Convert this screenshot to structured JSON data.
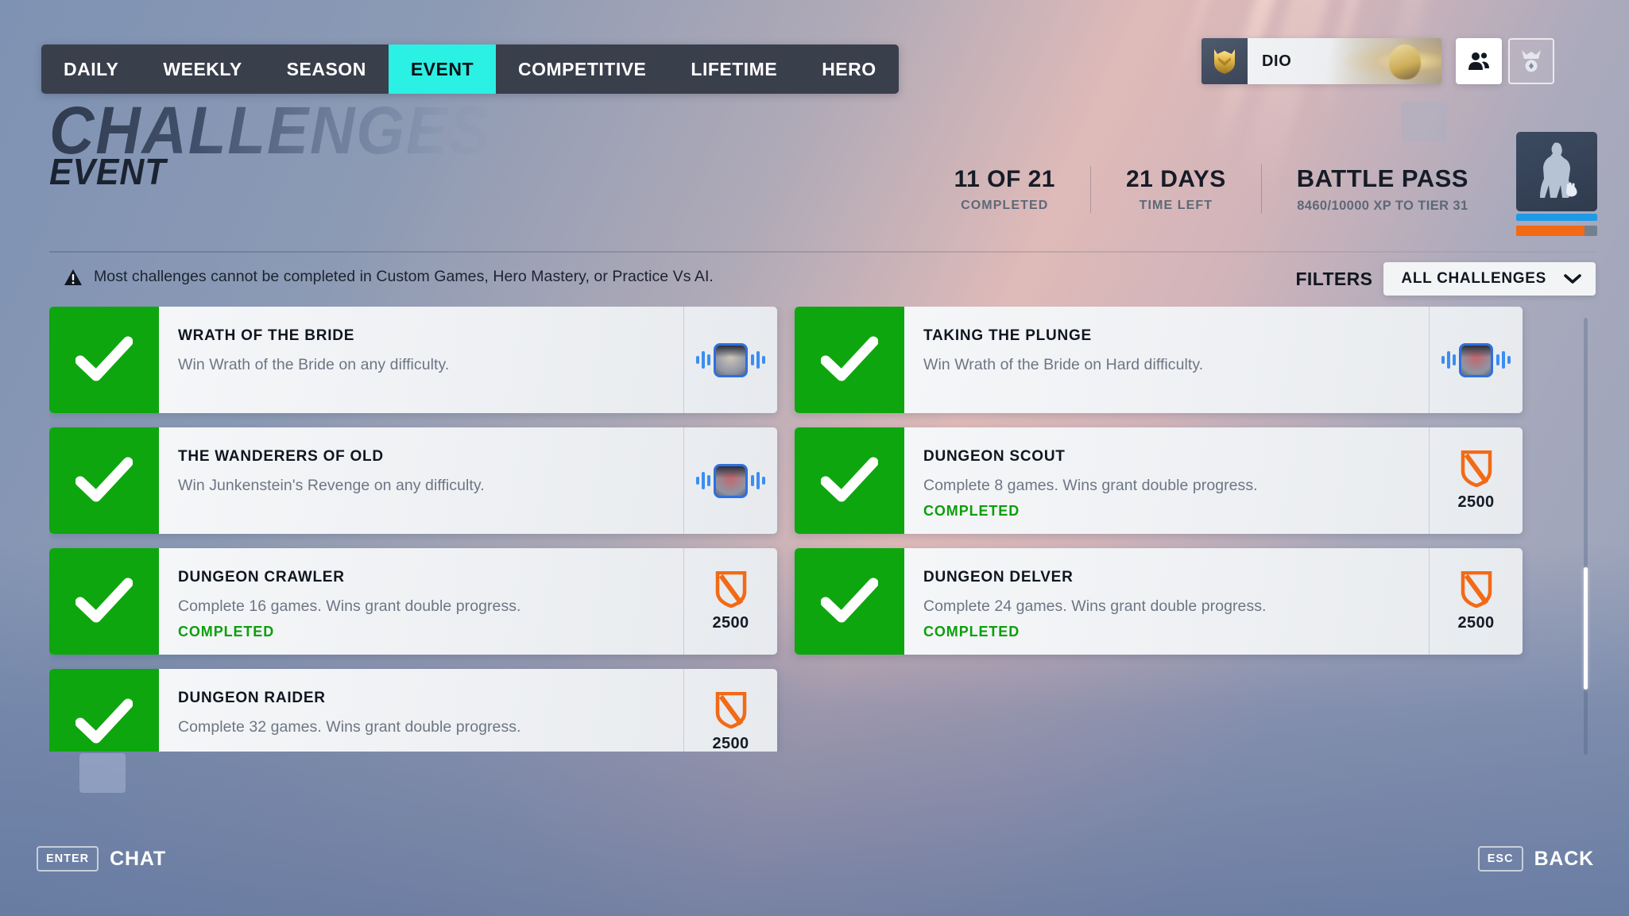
{
  "nav": {
    "tabs": [
      {
        "label": "DAILY",
        "active": false
      },
      {
        "label": "WEEKLY",
        "active": false
      },
      {
        "label": "SEASON",
        "active": false
      },
      {
        "label": "EVENT",
        "active": true
      },
      {
        "label": "COMPETITIVE",
        "active": false
      },
      {
        "label": "LIFETIME",
        "active": false
      },
      {
        "label": "HERO",
        "active": false
      }
    ],
    "active_tab": "EVENT",
    "active_color": "#2bf0e4"
  },
  "header": {
    "title": "CHALLENGES",
    "subtitle": "EVENT",
    "stats": [
      {
        "value": "11 OF 21",
        "label": "COMPLETED"
      },
      {
        "value": "21 DAYS",
        "label": "TIME LEFT"
      },
      {
        "value": "BATTLE PASS",
        "label": "8460/10000 XP TO TIER 31"
      }
    ]
  },
  "profile": {
    "name": "DIO",
    "badge_icon": "gold-shield-icon",
    "social_icon": "social-people-icon",
    "career_icon": "career-medal-icon"
  },
  "battle_pass": {
    "tier_progress_percent": 84,
    "accent_color": "#f26a16",
    "bar_color": "#1e9ae6",
    "thumb_icon": "hero-silhouette-icon"
  },
  "notice": {
    "icon": "warning-triangle-icon",
    "text": "Most challenges cannot be completed in Custom Games, Hero Mastery, or Practice Vs AI."
  },
  "filters": {
    "label": "FILTERS",
    "selected": "ALL CHALLENGES",
    "chevron_icon": "chevron-down-icon"
  },
  "challenges": {
    "left_column": [
      {
        "title": "WRATH OF THE BRIDE",
        "description": "Win Wrath of the Bride on any difficulty.",
        "status": "",
        "completed": true,
        "reward_type": "voice-line",
        "reward_amount": "",
        "portrait_tone": "#cfc6b8"
      },
      {
        "title": "THE WANDERERS OF OLD",
        "description": "Win Junkenstein's Revenge on any difficulty.",
        "status": "",
        "completed": true,
        "reward_type": "voice-line",
        "reward_amount": "",
        "portrait_tone": "#c4666a"
      },
      {
        "title": "DUNGEON CRAWLER",
        "description": "Complete 16 games. Wins grant double progress.",
        "status": "COMPLETED",
        "completed": true,
        "reward_type": "battle-pass-xp",
        "reward_amount": "2500",
        "portrait_tone": ""
      },
      {
        "title": "DUNGEON RAIDER",
        "description": "Complete 32 games. Wins grant double progress.",
        "status": "",
        "completed": true,
        "reward_type": "battle-pass-xp",
        "reward_amount": "2500",
        "portrait_tone": ""
      }
    ],
    "right_column": [
      {
        "title": "TAKING THE PLUNGE",
        "description": "Win Wrath of the Bride on Hard difficulty.",
        "status": "",
        "completed": true,
        "reward_type": "voice-line",
        "reward_amount": "",
        "portrait_tone": "#c4666a"
      },
      {
        "title": "DUNGEON SCOUT",
        "description": "Complete 8 games. Wins grant double progress.",
        "status": "COMPLETED",
        "completed": true,
        "reward_type": "battle-pass-xp",
        "reward_amount": "2500",
        "portrait_tone": ""
      },
      {
        "title": "DUNGEON DELVER",
        "description": "Complete 24 games. Wins grant double progress.",
        "status": "COMPLETED",
        "completed": true,
        "reward_type": "battle-pass-xp",
        "reward_amount": "2500",
        "portrait_tone": ""
      }
    ]
  },
  "scrollbar": {
    "thumb_top_percent": 57,
    "thumb_height_percent": 28
  },
  "footer": {
    "left": {
      "key": "ENTER",
      "label": "CHAT"
    },
    "right": {
      "key": "ESC",
      "label": "BACK"
    }
  },
  "colors": {
    "complete_green": "#0ea60e",
    "xp_orange": "#f26a16",
    "accent_cyan": "#2bf0e4",
    "card_bg": "#f2f4f7"
  }
}
